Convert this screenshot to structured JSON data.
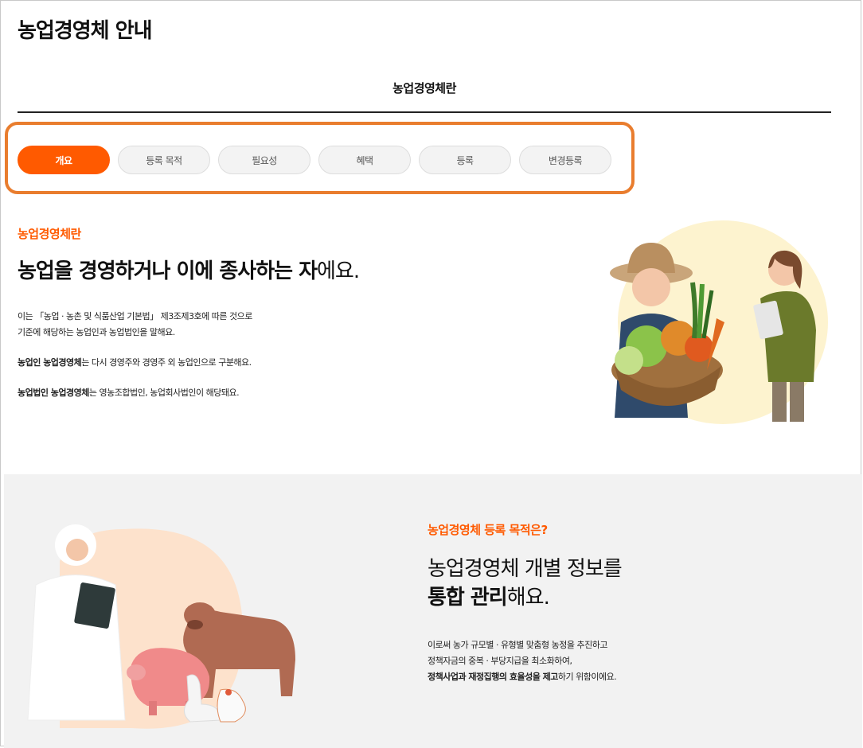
{
  "page": {
    "title": "농업경영체 안내"
  },
  "section_title": "농업경영체란",
  "tabs": [
    {
      "label": "개요",
      "active": true
    },
    {
      "label": "등록 목적",
      "active": false
    },
    {
      "label": "필요성",
      "active": false
    },
    {
      "label": "혜택",
      "active": false
    },
    {
      "label": "등록",
      "active": false
    },
    {
      "label": "변경등록",
      "active": false
    }
  ],
  "overview": {
    "kicker": "농업경영체란",
    "heading_bold": "농업을 경영하거나 이에 종사하는 자",
    "heading_rest": "에요.",
    "para1_line1": "이는 「농업 · 농촌 및 식품산업 기본법」 제3조제3호에 따른 것으로",
    "para1_line2": "기준에 해당하는 농업인과 농업법인을 말해요.",
    "para2_bold": "농업인 농업경영체",
    "para2_rest": "는 다시 경영주와 경영주 외 농업인으로 구분해요.",
    "para3_bold": "농업법인 농업경영체",
    "para3_rest": "는 영농조합법인, 농업회사법인이 해당돼요."
  },
  "purpose": {
    "kicker": "농업경영체 등록 목적은?",
    "heading_line1": "농업경영체 개별 정보를",
    "heading_line2_bold": "통합 관리",
    "heading_line2_rest": "해요.",
    "line1": "이로써 농가 규모별 · 유형별 맞춤형 농정을 추진하고",
    "line2": "정책자금의 중복 · 부당지급을 최소화하여,",
    "line3_bold": "정책사업과 재정집행의 효율성을 제고",
    "line3_rest": "하기 위함이에요."
  },
  "colors": {
    "accent": "#ff5a00",
    "highlight_outline": "#e97d2e",
    "section_bg": "#f2f2f2"
  }
}
